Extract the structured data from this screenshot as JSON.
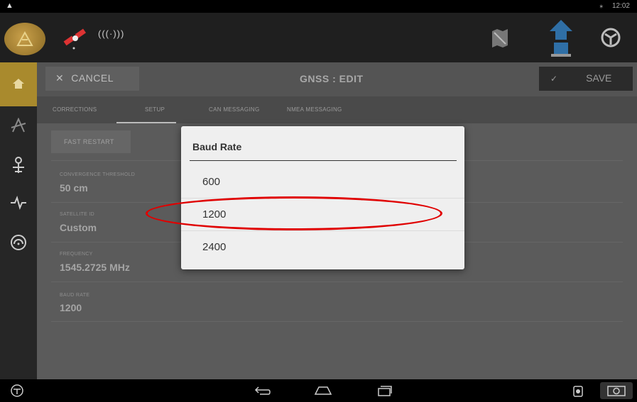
{
  "statusbar": {
    "time": "12:02"
  },
  "toolbar": {
    "cancel_label": "CANCEL",
    "title": "GNSS : EDIT",
    "save_label": "SAVE"
  },
  "appbar": {
    "signal_label": "(((·)))"
  },
  "tabs": [
    {
      "label": "CORRECTIONS"
    },
    {
      "label": "SETUP"
    },
    {
      "label": "CAN MESSAGING"
    },
    {
      "label": "NMEA MESSAGING"
    }
  ],
  "content": {
    "fast_restart_label": "FAST RESTART",
    "fields": [
      {
        "label": "CONVERGENCE THRESHOLD",
        "value": "50 cm"
      },
      {
        "label": "SATELLITE ID",
        "value": "Custom"
      },
      {
        "label": "FREQUENCY",
        "value": "1545.2725 MHz"
      },
      {
        "label": "BAUD RATE",
        "value": "1200"
      }
    ]
  },
  "dialog": {
    "title": "Baud Rate",
    "options": [
      "600",
      "1200",
      "2400"
    ],
    "selected": "1200"
  },
  "colors": {
    "accent_gold": "#a98a2d",
    "annotation_red": "#e00000",
    "implement_blue": "#2f6fa6"
  }
}
